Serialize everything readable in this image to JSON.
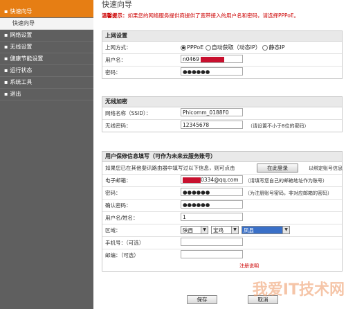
{
  "sidebar": {
    "items": [
      {
        "label": "快速向导",
        "active": true
      },
      {
        "label": "快速向导",
        "sub": true
      },
      {
        "label": "网络设置"
      },
      {
        "label": "无线设置"
      },
      {
        "label": "健康节能设置"
      },
      {
        "label": "运行状态"
      },
      {
        "label": "系统工具"
      },
      {
        "label": "退出"
      }
    ]
  },
  "header": {
    "title": "快速向导",
    "tip_label": "温馨提示：",
    "tip_text": "如果您的网络服务提供商提供了宽带接入的用户名和密码，请选择PPPoE。"
  },
  "internet": {
    "heading": "上网设置",
    "mode_label": "上网方式：",
    "options": [
      "PPPoE",
      "自动获取（动态IP）",
      "静态IP"
    ],
    "username_label": "用户名：",
    "username_value": "n0469",
    "password_label": "密码：",
    "password_value": "●●●●●●"
  },
  "wireless": {
    "heading": "无线加密",
    "ssid_label": "网络名称（SSID）：",
    "ssid_value": "Phicomm_0188F0",
    "pwd_label": "无线密码：",
    "pwd_value": "12345678",
    "pwd_hint": "（请设置不小于8位的密码）"
  },
  "cloud": {
    "heading": "用户保修信息填写（可作为未来云服务账号）",
    "intro": "如果您已在其他斐讯路由器中填写过以下信息，则可点击",
    "login_button": "在此登录",
    "intro_tail": "以绑定账号信息",
    "email_label": "电子邮箱：",
    "email_value": "0334@qq.com",
    "email_hint": "（请填写您自己的邮箱地址作为账号）",
    "pwd_label": "密码：",
    "pwd_value": "●●●●●●",
    "pwd_hint": "（为注册账号密码，非对应邮箱的密码）",
    "confirm_label": "确认密码：",
    "confirm_value": "●●●●●●",
    "name_label": "用户名/姓名：",
    "name_value": "1",
    "region_label": "区域：",
    "province": "陕西",
    "city": "宝鸡",
    "county": "凤县",
    "phone_label": "手机号：（可选）",
    "zip_label": "邮编：（可选）",
    "register_link": "注册说明"
  },
  "footer": {
    "save_label": "保存",
    "cancel_label": "取消"
  },
  "watermark": "我爱IT技术网"
}
